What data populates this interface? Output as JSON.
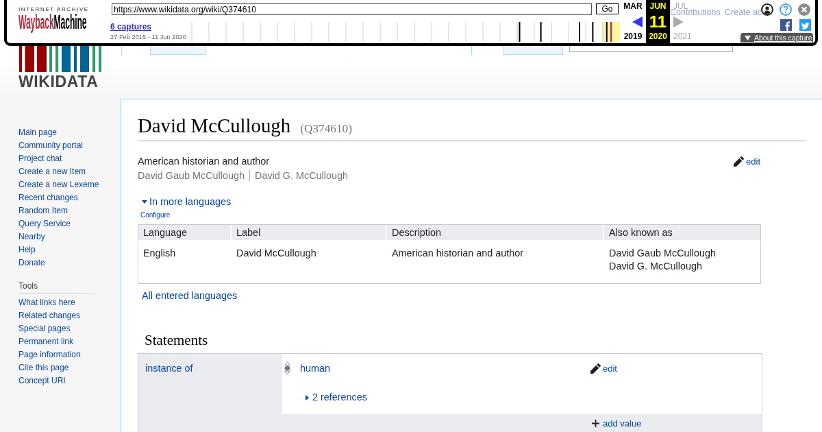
{
  "wayback": {
    "logo": {
      "top_line": "INTERNET ARCHIVE",
      "wayback": "Wayback",
      "machine": "Machine"
    },
    "url": {
      "value": "https://www.wikidata.org/wiki/Q374610"
    },
    "go_button": "Go",
    "captures": {
      "link": "6 captures",
      "range": "27 Feb 2015 - 11 Jun 2020"
    },
    "months": [
      {
        "month": "MAR",
        "year": "2019",
        "selected": false,
        "disabled": false,
        "arrow": {
          "kind": "prev",
          "disabled": false
        }
      },
      {
        "month": "JUN",
        "day": "11",
        "year": "2020",
        "selected": true,
        "disabled": false
      },
      {
        "month": "JUL",
        "year": "2021",
        "selected": false,
        "disabled": true,
        "arrow": {
          "kind": "next",
          "disabled": true
        }
      }
    ],
    "about_button": "About this capture",
    "faded_links": [
      "Contributions",
      "Create ac"
    ]
  },
  "site": {
    "logo_text": "WIKIDATA"
  },
  "namespace_tabs": [
    {
      "selected": true
    },
    {
      "selected": false
    }
  ],
  "view_tabs": [
    {
      "selected": true
    },
    {
      "selected": false
    }
  ],
  "sidebar": {
    "navigation": [
      "Main page",
      "Community portal",
      "Project chat",
      "Create a new Item",
      "Create a new Lexeme",
      "Recent changes",
      "Random Item",
      "Query Service",
      "Nearby",
      "Help",
      "Donate"
    ],
    "tools": {
      "heading": "Tools",
      "items": [
        "What links here",
        "Related changes",
        "Special pages",
        "Permanent link",
        "Page information",
        "Cite this page",
        "Concept URI"
      ]
    }
  },
  "item": {
    "label": "David McCullough",
    "id": "(Q374610)",
    "description": "American historian and author",
    "aliases": [
      "David Gaub McCullough",
      "David G. McCullough"
    ],
    "edit_link": "edit",
    "languages": {
      "toggle": "In more languages",
      "expanded": true,
      "configure": "Configure",
      "columns": [
        "Language",
        "Label",
        "Description",
        "Also known as"
      ],
      "rows": [
        {
          "language": "English",
          "label": "David McCullough",
          "description": "American historian and author",
          "aliases": [
            "David Gaub McCullough",
            "David G. McCullough"
          ]
        }
      ],
      "all_link": "All entered languages"
    },
    "statements": {
      "heading": "Statements",
      "groups": [
        {
          "property": "instance of",
          "values": [
            {
              "value": "human",
              "edit_link": "edit",
              "references": {
                "label": "2 references",
                "expanded": false
              }
            }
          ],
          "add_value": "add value"
        }
      ]
    }
  }
}
